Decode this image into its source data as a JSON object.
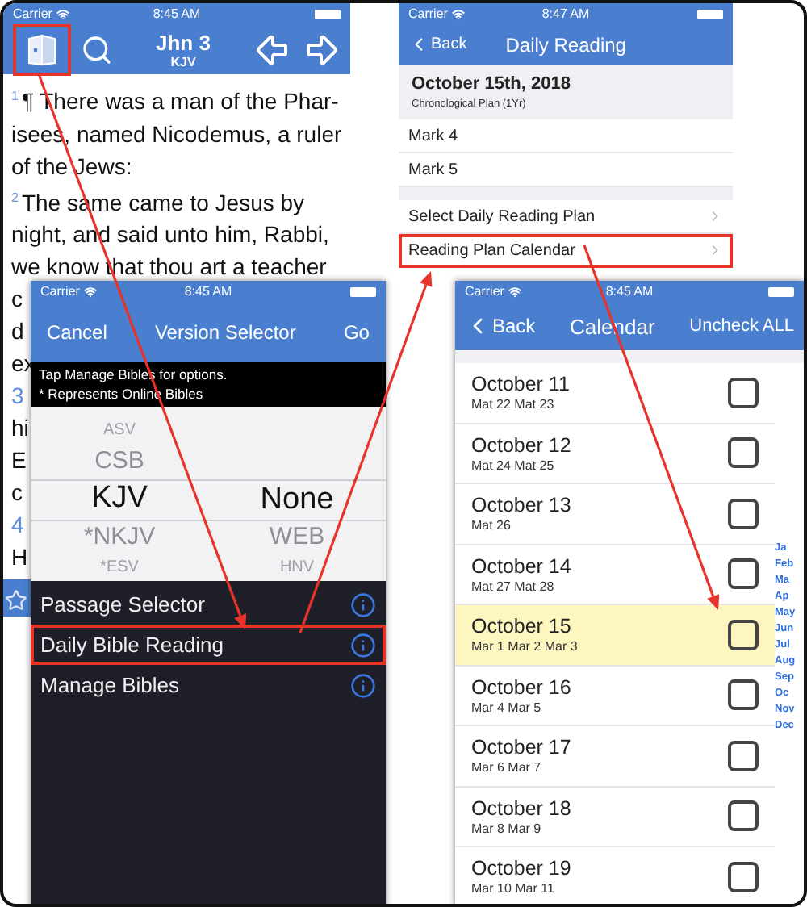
{
  "reader": {
    "status": {
      "carrier": "Carrier",
      "time": "8:45 AM"
    },
    "title": "Jhn 3",
    "version": "KJV",
    "book_button": {
      "highlighted": true
    },
    "lines": [
      {
        "kind": "text",
        "verse": "1",
        "text": "¶ There was a man of the Phar-"
      },
      {
        "kind": "text",
        "text": "isees, named Nicodemus, a ruler"
      },
      {
        "kind": "text",
        "text": "of the Jews:"
      },
      {
        "kind": "text",
        "verse": "2",
        "text": "The same came to Jesus by"
      },
      {
        "kind": "text",
        "text": "night, and said unto him, Rabbi,"
      },
      {
        "kind": "text",
        "text": "we know that thou art a teacher"
      },
      {
        "kind": "text",
        "text": "c"
      },
      {
        "kind": "text",
        "text": "d"
      },
      {
        "kind": "text",
        "text": "ex"
      },
      {
        "kind": "verse_number",
        "text": "3"
      },
      {
        "kind": "text",
        "text": "hi"
      },
      {
        "kind": "text",
        "text": "E"
      },
      {
        "kind": "text",
        "text": "c"
      },
      {
        "kind": "verse_number",
        "text": "4"
      },
      {
        "kind": "text",
        "text": "H"
      }
    ]
  },
  "version_selector": {
    "status": {
      "carrier": "Carrier",
      "time": "8:45 AM"
    },
    "cancel": "Cancel",
    "title": "Version Selector",
    "go": "Go",
    "info": [
      "Tap Manage Bibles for options.",
      "* Represents Online Bibles"
    ],
    "picker": [
      {
        "items": [
          {
            "label": "ASV",
            "selected": false
          },
          {
            "label": "CSB",
            "selected": false
          },
          {
            "label": "KJV",
            "selected": true
          },
          {
            "label": "*NKJV",
            "selected": false
          },
          {
            "label": "*ESV",
            "selected": false
          }
        ]
      },
      {
        "items": [
          {
            "label": "None",
            "selected": true
          },
          {
            "label": "WEB",
            "selected": false
          },
          {
            "label": "HNV",
            "selected": false
          }
        ]
      }
    ],
    "menu": [
      {
        "label": "Passage Selector",
        "highlighted": false
      },
      {
        "label": "Daily Bible Reading",
        "highlighted": true
      },
      {
        "label": "Manage Bibles",
        "highlighted": false
      }
    ]
  },
  "daily_reading": {
    "status": {
      "carrier": "Carrier",
      "time": "8:47 AM"
    },
    "back": "Back",
    "title": "Daily Reading",
    "date": "October 15th, 2018",
    "plan": "Chronological Plan (1Yr)",
    "readings": [
      "Mark 4",
      "Mark 5"
    ],
    "options": [
      {
        "label": "Select Daily Reading Plan",
        "highlighted": false
      },
      {
        "label": "Reading Plan Calendar",
        "highlighted": true
      }
    ]
  },
  "calendar": {
    "status": {
      "carrier": "Carrier",
      "time": "8:45 AM"
    },
    "back": "Back",
    "title": "Calendar",
    "uncheck_all": "Uncheck ALL",
    "days": [
      {
        "date": "October 11",
        "readings": "Mat 22 Mat 23",
        "today": false,
        "checked": false
      },
      {
        "date": "October 12",
        "readings": "Mat 24 Mat 25",
        "today": false,
        "checked": false
      },
      {
        "date": "October 13",
        "readings": "Mat 26",
        "today": false,
        "checked": false
      },
      {
        "date": "October 14",
        "readings": "Mat 27 Mat 28",
        "today": false,
        "checked": false
      },
      {
        "date": "October 15",
        "readings": "Mar 1 Mar 2 Mar 3",
        "today": true,
        "checked": false
      },
      {
        "date": "October 16",
        "readings": "Mar 4 Mar 5",
        "today": false,
        "checked": false
      },
      {
        "date": "October 17",
        "readings": "Mar 6 Mar 7",
        "today": false,
        "checked": false
      },
      {
        "date": "October 18",
        "readings": "Mar 8 Mar 9",
        "today": false,
        "checked": false
      },
      {
        "date": "October 19",
        "readings": "Mar 10 Mar 11",
        "today": false,
        "checked": false
      }
    ],
    "months": [
      "Ja",
      "Feb",
      "Ma",
      "Ap",
      "May",
      "Jun",
      "Jul",
      "Aug",
      "Sep",
      "Oc",
      "Nov",
      "Dec"
    ]
  }
}
